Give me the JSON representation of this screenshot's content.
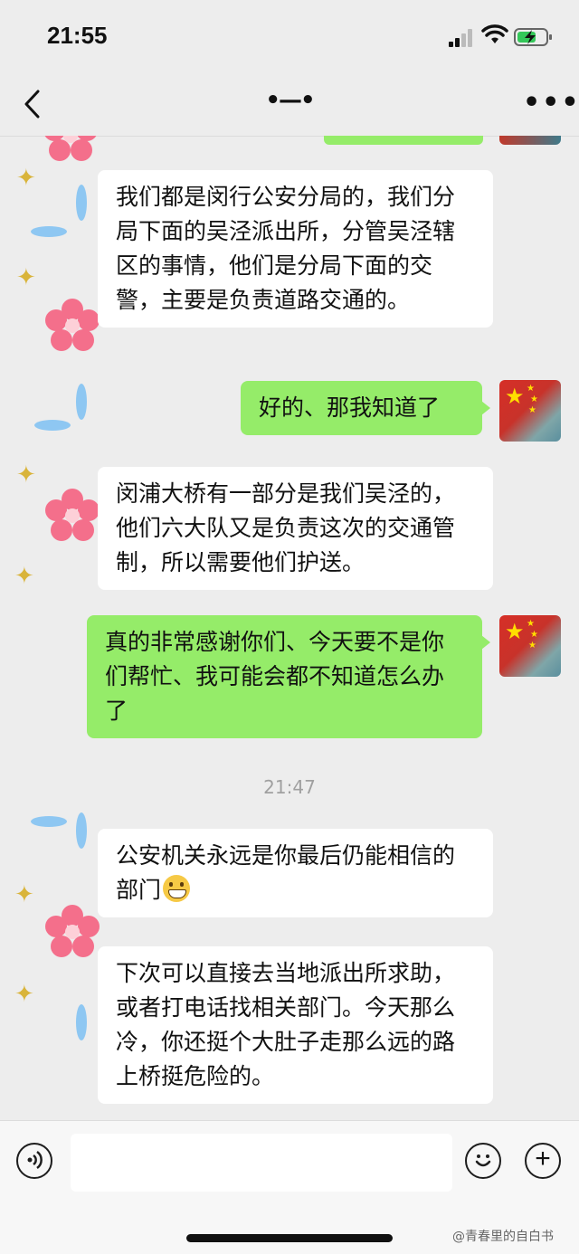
{
  "status_bar": {
    "time": "21:55"
  },
  "nav": {
    "title": "•—•",
    "more": "•••"
  },
  "messages": [
    {
      "side": "left",
      "text": "我们都是闵行公安分局的，我们分局下面的吴泾派出所，分管吴泾辖区的事情，他们是分局下面的交警，主要是负责道路交通的。"
    },
    {
      "side": "right",
      "text": "好的、那我知道了"
    },
    {
      "side": "left",
      "text": "闵浦大桥有一部分是我们吴泾的，他们六大队又是负责这次的交通管制，所以需要他们护送。"
    },
    {
      "side": "right",
      "text": "真的非常感谢你们、今天要不是你们帮忙、我可能会都不知道怎么办了"
    },
    {
      "side": "time",
      "text": "21:47"
    },
    {
      "side": "left",
      "text": "公安机关永远是你最后仍能相信的部门",
      "emoji": "grinning-face"
    },
    {
      "side": "left",
      "text": "下次可以直接去当地派出所求助，或者打电话找相关部门。今天那么冷，你还挺个大肚子走那么远的路上桥挺危险的。"
    }
  ],
  "input_bar": {
    "placeholder": ""
  },
  "watermark": "@青春里的自白书",
  "colors": {
    "background": "#ededed",
    "bubble_left": "#ffffff",
    "bubble_right": "#95ec69"
  },
  "icons": [
    "back-icon",
    "more-icon",
    "voice-icon",
    "emoji-icon",
    "plus-icon"
  ]
}
